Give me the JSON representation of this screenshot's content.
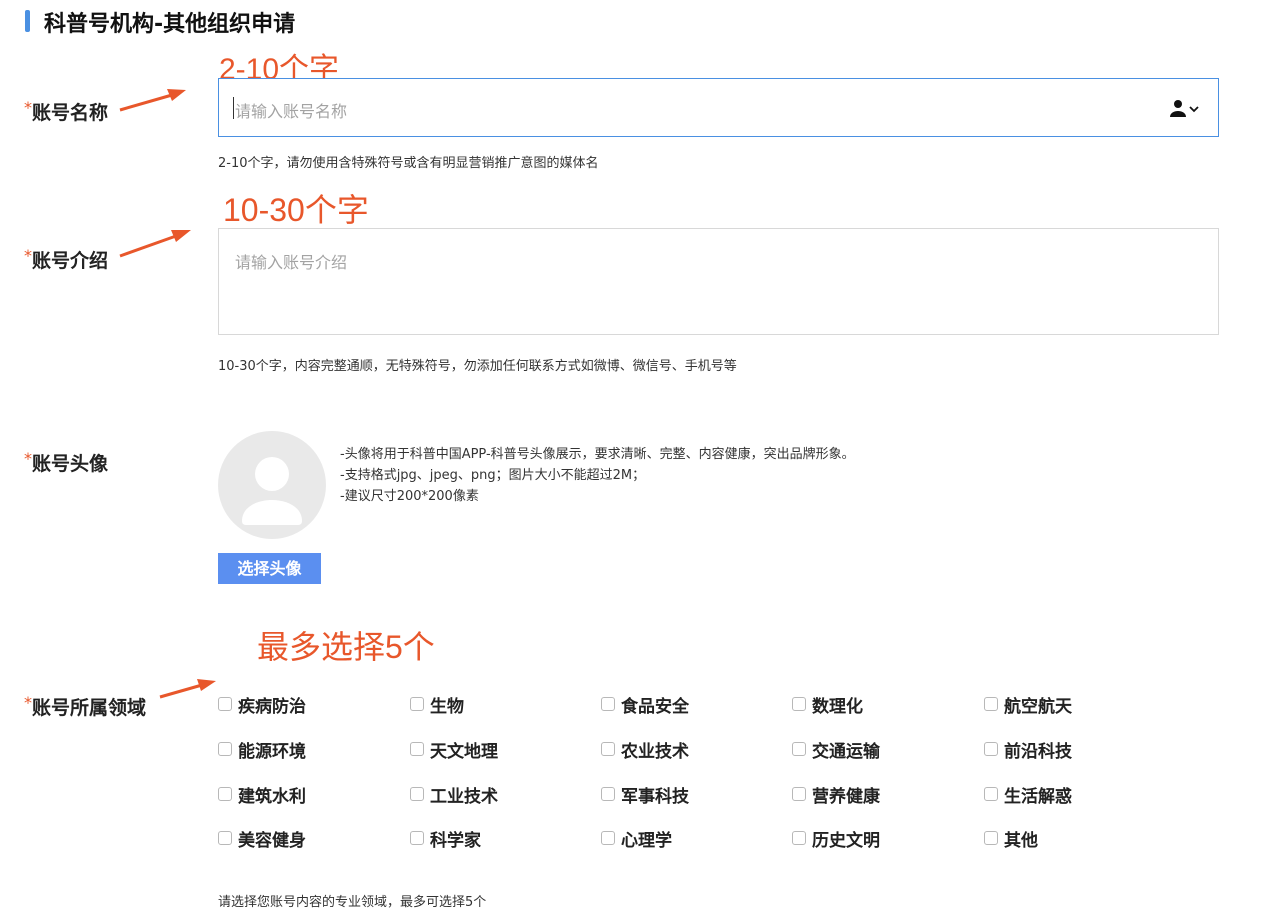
{
  "page": {
    "title": "科普号机构-其他组织申请"
  },
  "annotations": {
    "name_hint": "2-10个字",
    "intro_hint": "10-30个字",
    "domain_hint": "最多选择5个"
  },
  "colors": {
    "accent": "#4a90e2",
    "button": "#5b8ff0",
    "annotation": "#e8572b",
    "required": "#e8572b"
  },
  "form": {
    "required_mark": "*",
    "name": {
      "label": "账号名称",
      "placeholder": "请输入账号名称",
      "hint": "2-10个字，请勿使用含特殊符号或含有明显营销推广意图的媒体名",
      "icon": "person-dropdown-icon"
    },
    "intro": {
      "label": "账号介绍",
      "placeholder": "请输入账号介绍",
      "hint": "10-30个字，内容完整通顺，无特殊符号，勿添加任何联系方式如微博、微信号、手机号等"
    },
    "avatar": {
      "label": "账号头像",
      "notes": [
        "-头像将用于科普中国APP-科普号头像展示，要求清晰、完整、内容健康，突出品牌形象。",
        "-支持格式jpg、jpeg、png；图片大小不能超过2M；",
        "-建议尺寸200*200像素"
      ],
      "button": "选择头像"
    },
    "domain": {
      "label": "账号所属领域",
      "options": [
        [
          "疾病防治",
          "生物",
          "食品安全",
          "数理化",
          "航空航天"
        ],
        [
          "能源环境",
          "天文地理",
          "农业技术",
          "交通运输",
          "前沿科技"
        ],
        [
          "建筑水利",
          "工业技术",
          "军事科技",
          "营养健康",
          "生活解惑"
        ],
        [
          "美容健身",
          "科学家",
          "心理学",
          "历史文明",
          "其他"
        ]
      ],
      "hint": "请选择您账号内容的专业领域，最多可选择5个"
    }
  }
}
